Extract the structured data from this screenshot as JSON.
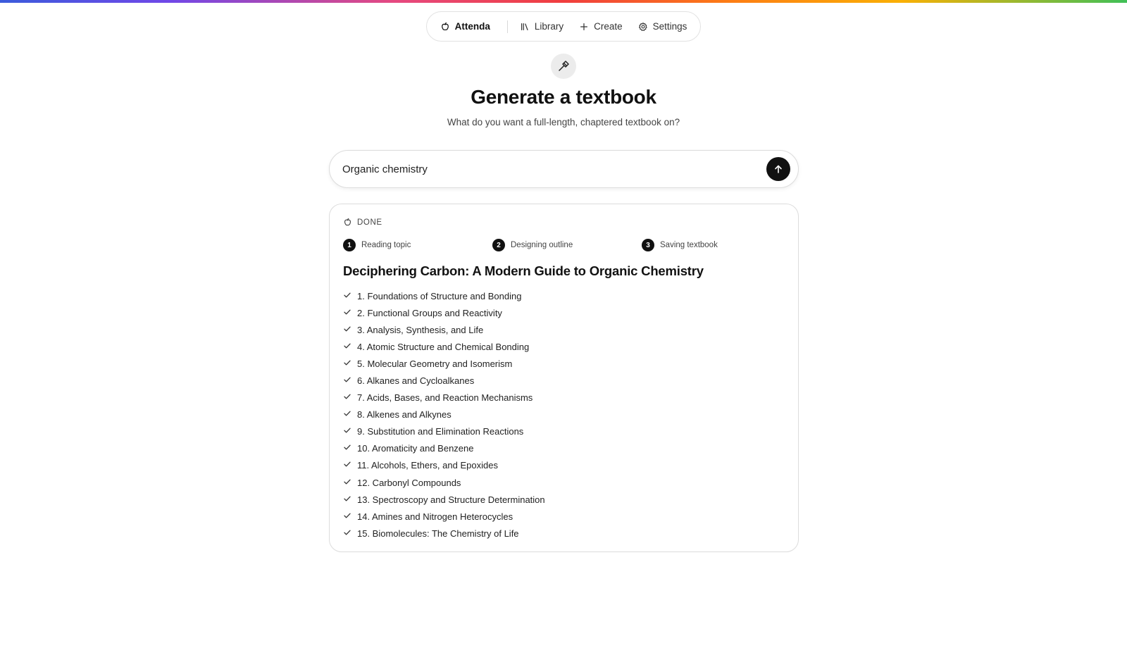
{
  "nav": {
    "brand": "Attenda",
    "library": "Library",
    "create": "Create",
    "settings": "Settings"
  },
  "hero": {
    "icon": "hammer-icon",
    "title": "Generate a textbook",
    "subtitle": "What do you want a full-length, chaptered textbook on?"
  },
  "prompt": {
    "value": "Organic chemistry"
  },
  "result": {
    "status": "DONE",
    "steps": [
      {
        "num": "1",
        "label": "Reading topic"
      },
      {
        "num": "2",
        "label": "Designing outline"
      },
      {
        "num": "3",
        "label": "Saving textbook"
      }
    ],
    "book_title": "Deciphering Carbon: A Modern Guide to Organic Chemistry",
    "chapters": [
      "1. Foundations of Structure and Bonding",
      "2. Functional Groups and Reactivity",
      "3. Analysis, Synthesis, and Life",
      "4. Atomic Structure and Chemical Bonding",
      "5. Molecular Geometry and Isomerism",
      "6. Alkanes and Cycloalkanes",
      "7. Acids, Bases, and Reaction Mechanisms",
      "8. Alkenes and Alkynes",
      "9. Substitution and Elimination Reactions",
      "10. Aromaticity and Benzene",
      "11. Alcohols, Ethers, and Epoxides",
      "12. Carbonyl Compounds",
      "13. Spectroscopy and Structure Determination",
      "14. Amines and Nitrogen Heterocycles",
      "15. Biomolecules: The Chemistry of Life"
    ]
  },
  "colors": {
    "accent": "#111111",
    "border": "#dcdcdc",
    "muted_text": "#444444"
  }
}
